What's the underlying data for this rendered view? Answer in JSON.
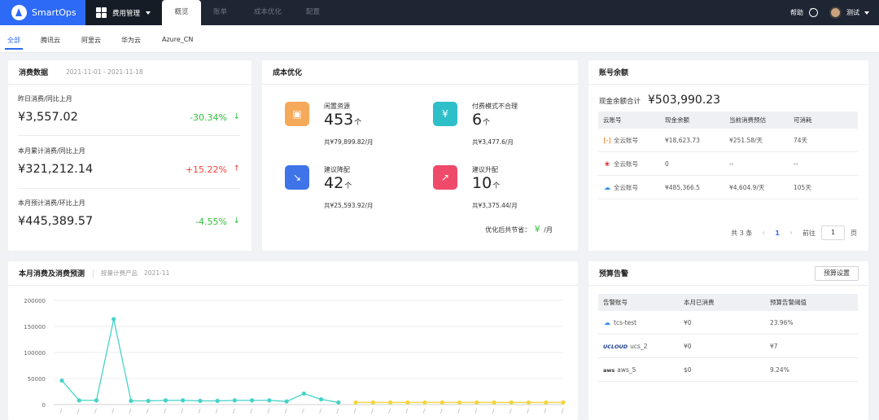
{
  "topbar": {
    "brand": "SmartOps",
    "menu_label": "费用管理",
    "tabs": [
      "概览",
      "账单",
      "成本优化",
      "配置"
    ],
    "help": "帮助",
    "user": "测试"
  },
  "subtabs": [
    "全部",
    "腾讯云",
    "阿里云",
    "华为云",
    "Azure_CN"
  ],
  "spend": {
    "title": "消费数据",
    "date_range": "2021-11-01 - 2021-11-18",
    "items": [
      {
        "label": "昨日消费/同比上月",
        "value": "¥3,557.02",
        "change": "-30.34%",
        "arrow": "↓",
        "color": "#2fbf3c"
      },
      {
        "label": "本月累计消费/同比上月",
        "value": "¥321,212.14",
        "change": "+15.22%",
        "arrow": "↑",
        "color": "#f5433b"
      },
      {
        "label": "本月预计消费/环比上月",
        "value": "¥445,389.57",
        "change": "-4.55%",
        "arrow": "↓",
        "color": "#2fbf3c"
      }
    ]
  },
  "optimization": {
    "title": "成本优化",
    "items": [
      {
        "label": "闲置资源",
        "count": "453",
        "unit": "个",
        "total": "共¥79,899.82/月",
        "icon": "idle-resource-icon",
        "color": "#f5a95a"
      },
      {
        "label": "付费模式不合理",
        "count": "6",
        "unit": "个",
        "total": "共¥3,477.6/月",
        "icon": "money-bag-icon",
        "color": "#2fbfc9"
      },
      {
        "label": "建议降配",
        "count": "42",
        "unit": "个",
        "total": "共¥25,593.92/月",
        "icon": "downgrade-icon",
        "color": "#3f73e8"
      },
      {
        "label": "建议升配",
        "count": "10",
        "unit": "个",
        "total": "共¥3,375.44/月",
        "icon": "upgrade-icon",
        "color": "#ef4a69"
      }
    ],
    "saving_label": "优化后共节省：",
    "saving_value": "¥",
    "saving_unit": "/月"
  },
  "balance": {
    "title": "账号余额",
    "total_label": "现金余额合计",
    "total_value": "¥503,990.23",
    "headers": [
      "云账号",
      "现金余额",
      "当前消费预估",
      "可消耗"
    ],
    "rows": [
      {
        "account": "全云账号",
        "icon": "aliyun-icon",
        "icon_color": "#ff6a00",
        "cash": "¥18,623.73",
        "estimate": "¥251.58/天",
        "days": "74天"
      },
      {
        "account": "全云账号",
        "icon": "huawei-icon",
        "icon_color": "#e0282e",
        "cash": "0",
        "estimate": "--",
        "days": "--"
      },
      {
        "account": "全云账号",
        "icon": "tencent-cloud-icon",
        "icon_color": "#2d8cf0",
        "cash": "¥485,366.5",
        "estimate": "¥4,604.9/天",
        "days": "105天"
      }
    ],
    "pager": {
      "total": "共 3 条",
      "current": "1",
      "goto": "前往",
      "page_value": "1",
      "page_unit": "页"
    }
  },
  "trend": {
    "title": "本月消费及消费预测",
    "subtitle": "按量计费产品",
    "month": "2021-11"
  },
  "chart_data": {
    "type": "line",
    "ylim": [
      0,
      200000
    ],
    "yticks": [
      "200000",
      "150000",
      "100000",
      "50000",
      "0"
    ],
    "series": [
      {
        "color": "#45d3c7",
        "values": [
          46000,
          8000,
          8000,
          164000,
          7000,
          7000,
          8000,
          8000,
          7000,
          7000,
          8000,
          8000,
          8000,
          6000,
          21000,
          10000,
          4000
        ]
      },
      {
        "color": "#f6d33e",
        "values": [
          4000,
          4000,
          4000,
          4000,
          4000,
          4000,
          4000,
          4000,
          4000,
          4000,
          4000,
          4000,
          4000
        ]
      }
    ]
  },
  "budget": {
    "title": "预算告警",
    "button": "预算设置",
    "headers": [
      "告警账号",
      "本月已消费",
      "预算告警阈值"
    ],
    "rows": [
      {
        "account": "tcs-test",
        "icon": "tencent-cloud-icon",
        "icon_color": "#2d8cf0",
        "spent": "¥0",
        "threshold": "23.96%"
      },
      {
        "account": "ucs_2",
        "icon": "ucloud-icon",
        "icon_color": "#1b3f8f",
        "icon_text": "UCLOUD",
        "spent": "¥0",
        "threshold": "¥7"
      },
      {
        "account": "aws_5",
        "icon": "aws-icon",
        "icon_color": "#333333",
        "icon_text": "aws",
        "spent": "$0",
        "threshold": "9.24%"
      }
    ]
  }
}
